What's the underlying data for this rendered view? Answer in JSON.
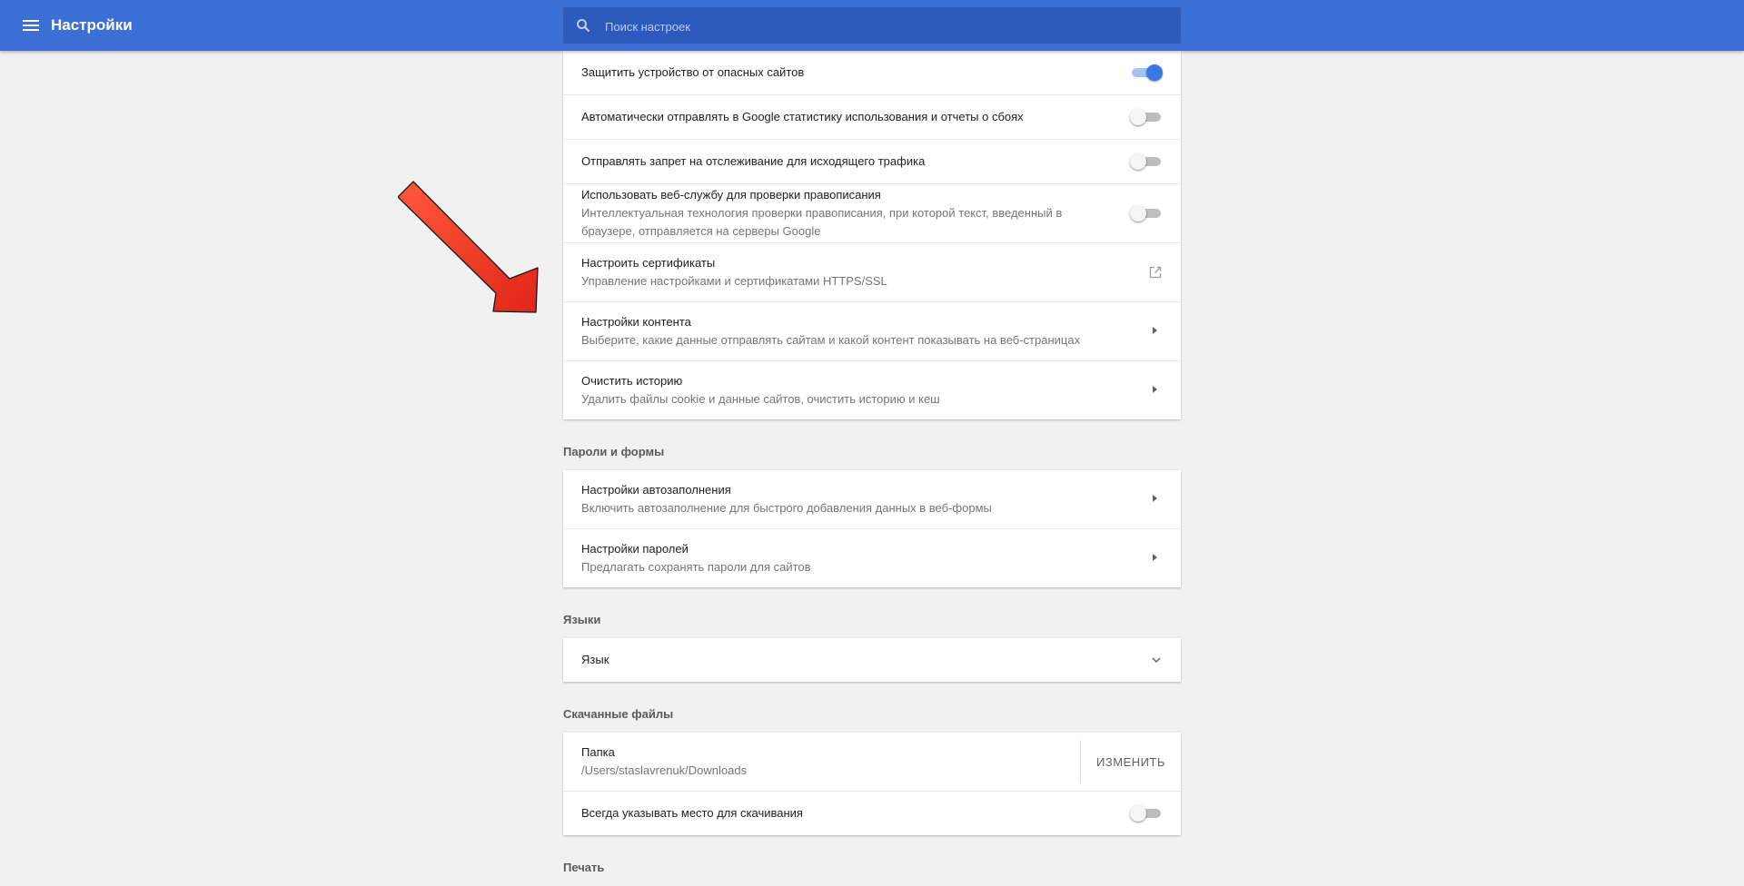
{
  "header": {
    "title": "Настройки",
    "search_placeholder": "Поиск настроек"
  },
  "privacy": {
    "protect_device": "Защитить устройство от опасных сайтов",
    "send_stats": "Автоматически отправлять в Google статистику использования и отчеты о сбоях",
    "do_not_track": "Отправлять запрет на отслеживание для исходящего трафика",
    "spellcheck": {
      "title": "Использовать веб-службу для проверки правописания",
      "subtitle": "Интеллектуальная технология проверки правописания, при которой текст, введенный в браузере, отправляется на серверы Google"
    },
    "certificates": {
      "title": "Настроить сертификаты",
      "subtitle": "Управление настройками и сертификатами HTTPS/SSL"
    },
    "content_settings": {
      "title": "Настройки контента",
      "subtitle": "Выберите, какие данные отправлять сайтам и какой контент показывать на веб-страницах"
    },
    "clear_history": {
      "title": "Очистить историю",
      "subtitle": "Удалить файлы cookie и данные сайтов, очистить историю и кеш"
    }
  },
  "passwords_section": {
    "title": "Пароли и формы",
    "autofill": {
      "title": "Настройки автозаполнения",
      "subtitle": "Включить автозаполнение для быстрого добавления данных в веб-формы"
    },
    "passwords": {
      "title": "Настройки паролей",
      "subtitle": "Предлагать сохранять пароли для сайтов"
    }
  },
  "languages_section": {
    "title": "Языки",
    "language_label": "Язык"
  },
  "downloads_section": {
    "title": "Скачанные файлы",
    "folder_label": "Папка",
    "folder_path": "/Users/staslavrenuk/Downloads",
    "change_button": "ИЗМЕНИТЬ",
    "ask_location": "Всегда указывать место для скачивания"
  },
  "print_section": {
    "title": "Печать"
  },
  "toggles": {
    "protect_device": true,
    "send_stats": false,
    "do_not_track": false,
    "spellcheck": false,
    "ask_location": false
  },
  "colors": {
    "header": "#3b6fd6",
    "search_box": "#2c5bbd",
    "toggle_on": "#3b78e7",
    "annotation_arrow": "#e8331e"
  },
  "icons": {
    "menu": "hamburger-icon",
    "search": "search-icon",
    "external": "open-in-new-icon",
    "submenu": "arrow-right-icon",
    "expand": "chevron-down-icon",
    "annotation": "red-arrow-annotation"
  }
}
